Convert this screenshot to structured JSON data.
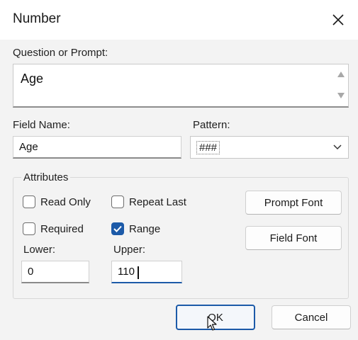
{
  "window": {
    "title": "Number"
  },
  "prompt": {
    "label": "Question or Prompt:",
    "value": "Age"
  },
  "field_name": {
    "label": "Field Name:",
    "value": "Age"
  },
  "pattern": {
    "label": "Pattern:",
    "value": "###"
  },
  "attributes": {
    "title": "Attributes",
    "read_only": {
      "label": "Read Only",
      "checked": false
    },
    "repeat_last": {
      "label": "Repeat Last",
      "checked": false
    },
    "required": {
      "label": "Required",
      "checked": false
    },
    "range": {
      "label": "Range",
      "checked": true
    }
  },
  "lower": {
    "label": "Lower:",
    "value": "0"
  },
  "upper": {
    "label": "Upper:",
    "value": "110"
  },
  "buttons": {
    "prompt_font": "Prompt Font",
    "field_font": "Field Font",
    "ok": "OK",
    "cancel": "Cancel"
  },
  "colors": {
    "accent": "#1c5aa8",
    "dialog_bg": "#f3f3f3"
  },
  "icons": {
    "close": "close-icon",
    "scroll_up": "scroll-up-icon",
    "scroll_down": "scroll-down-icon",
    "dropdown": "chevron-down-icon",
    "checkmark": "checkmark-icon",
    "cursor": "mouse-pointer-icon"
  }
}
